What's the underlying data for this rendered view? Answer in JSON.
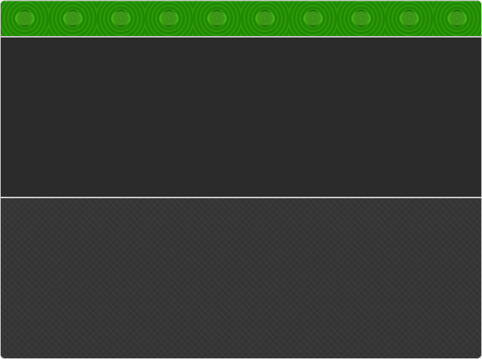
{
  "window": {
    "title": "",
    "titlebar_color": "#1f8a00",
    "main_panel_color": "#2b2b2b",
    "lower_panel_color": "#363636",
    "divider_color": "#c7c7c7"
  }
}
